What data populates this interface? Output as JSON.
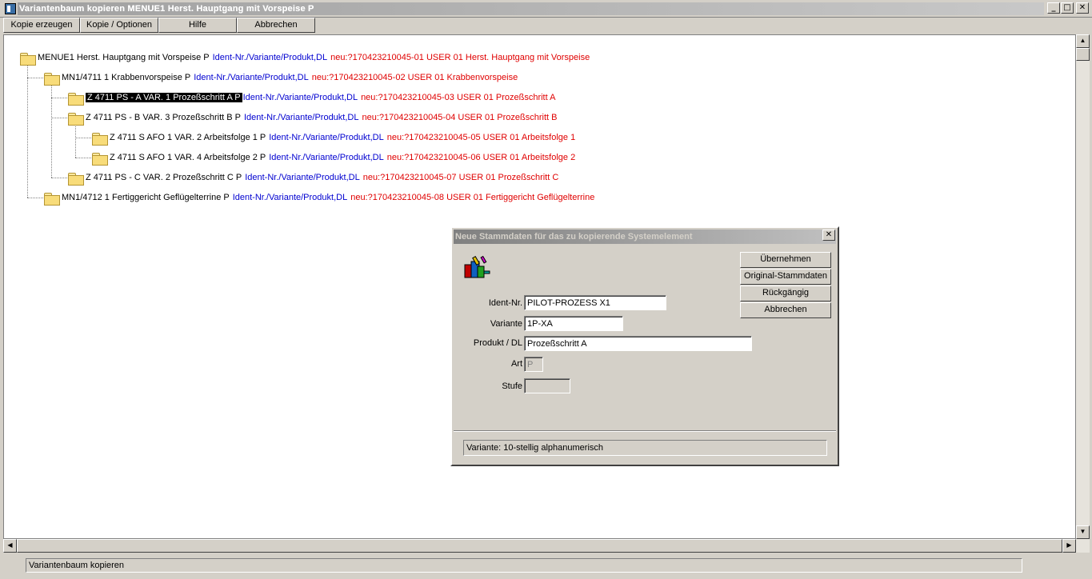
{
  "window": {
    "title": "Variantenbaum kopieren MENUE1   Herst. Hauptgang mit Vorspeise  P",
    "btn_minimize": "_",
    "btn_maximize": "□",
    "btn_close": "✕"
  },
  "toolbar": {
    "kopie_erzeugen": "Kopie erzeugen",
    "kopie_optionen": "Kopie / Optionen",
    "hilfe": "Hilfe",
    "abbrechen": "Abbrechen"
  },
  "tree": {
    "nodes": [
      {
        "text": "MENUE1   Herst. Hauptgang mit Vorspeise  P",
        "blue": "Ident-Nr./Variante/Produkt,DL",
        "red": "neu:?1704232100​45-01  USER 01  Herst. Hauptgang mit Vorspeise"
      },
      {
        "text": "MN1/4711  1  Krabbenvorspeise  P",
        "blue": "Ident-Nr./Variante/Produkt,DL",
        "red": "neu:?170423210045-02  USER 01  Krabbenvorspeise"
      },
      {
        "text": "Z 4711 PS - A  VAR. 1  Prozeßschritt A  P",
        "blue": "Ident-Nr./Variante/Produkt,DL",
        "red": "neu:?170423210045-03  USER 01  Prozeßschritt A"
      },
      {
        "text": "Z 4711 PS - B  VAR. 3  Prozeßschritt B  P",
        "blue": "Ident-Nr./Variante/Produkt,DL",
        "red": "neu:?170423210045-04  USER 01  Prozeßschritt B"
      },
      {
        "text": "Z 4711 S AFO 1  VAR. 2  Arbeitsfolge 1  P",
        "blue": "Ident-Nr./Variante/Produkt,DL",
        "red": "neu:?170423210045-05  USER 01  Arbeitsfolge 1"
      },
      {
        "text": "Z 4711 S AFO 1  VAR. 4  Arbeitsfolge 2  P",
        "blue": "Ident-Nr./Variante/Produkt,DL",
        "red": "neu:?170423210045-06  USER 01  Arbeitsfolge 2"
      },
      {
        "text": "Z 4711 PS - C  VAR. 2  Prozeßschritt C  P",
        "blue": "Ident-Nr./Variante/Produkt,DL",
        "red": "neu:?170423210045-07  USER 01  Prozeßschritt C"
      },
      {
        "text": "MN1/4712  1  Fertiggericht Geflügelterrine  P",
        "blue": "Ident-Nr./Variante/Produkt,DL",
        "red": "neu:?170423210045-08  USER 01  Fertiggericht Geflügelterrine"
      }
    ]
  },
  "status": {
    "text": "Variantenbaum kopieren"
  },
  "dialog": {
    "title": "Neue Stammdaten für das zu kopierende Systemelement",
    "close": "✕",
    "buttons": {
      "uebernehmen": "Übernehmen",
      "original": "Original-Stammdaten",
      "rueckgaengig": "Rückgängig",
      "abbrechen": "Abbrechen"
    },
    "labels": {
      "ident": "Ident-Nr.",
      "variante": "Variante",
      "produkt": "Produkt / DL",
      "art": "Art",
      "stufe": "Stufe"
    },
    "values": {
      "ident": "PILOT-PROZESS X1",
      "variante": "1P-XA",
      "produkt": "Prozeßschritt A",
      "art": "P",
      "stufe": ""
    },
    "status": "Variante: 10-stellig alphanumerisch"
  }
}
